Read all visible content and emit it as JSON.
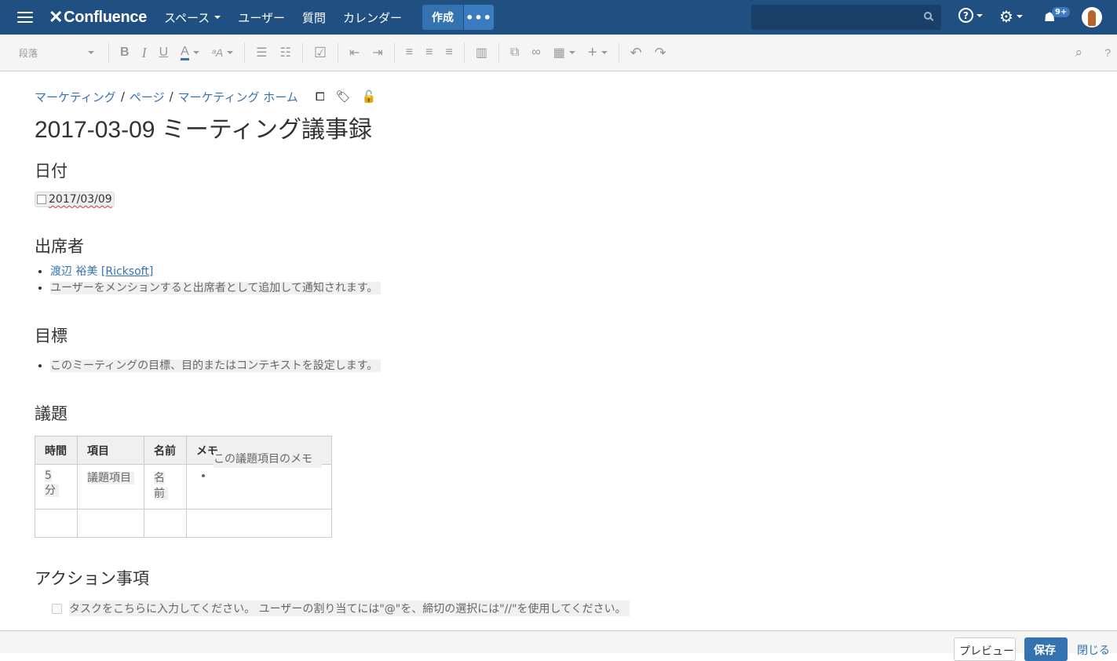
{
  "nav": {
    "logo": "Confluence",
    "spaces": "スペース",
    "users": "ユーザー",
    "questions": "質問",
    "calendar": "カレンダー",
    "create": "作成",
    "more": "•••",
    "help": "?",
    "notif_badge": "9+"
  },
  "toolbar": {
    "format": "段落",
    "bold": "B",
    "italic": "I",
    "underline": "U",
    "color": "A",
    "style": "ᵃA",
    "help": "?"
  },
  "page": {
    "breadcrumb": [
      "マーケティング",
      "ページ",
      "マーケティング ホーム"
    ],
    "title": "2017-03-09 ミーティング議事録",
    "date_heading": "日付",
    "date_value": "2017/03/09",
    "attendees_heading": "出席者",
    "attendee_name": "渡辺 裕美",
    "attendee_org": "[Ricksoft]",
    "attendee_hint": "ユーザーをメンションすると出席者として追加して通知されます。",
    "goals_heading": "目標",
    "goals_hint": "このミーティングの目標、目的またはコンテキストを設定します。",
    "agenda_heading": "議題",
    "agenda_table": {
      "headers": [
        "時間",
        "項目",
        "名前",
        "メモ"
      ],
      "row": [
        "5 分",
        "議題項目",
        "名前",
        "この議題項目のメモ"
      ]
    },
    "actions_heading": "アクション事項",
    "task_hint": "タスクをこちらに入力してください。 ユーザーの割り当てには\"@\"を、締切の選択には\"//\"を使用してください。"
  },
  "footer": {
    "preview": "プレビュー",
    "save": "保存",
    "close": "閉じる"
  },
  "colors": {
    "nav_bg": "#205081",
    "link": "#3572b0",
    "save_btn": "#3572b0"
  }
}
